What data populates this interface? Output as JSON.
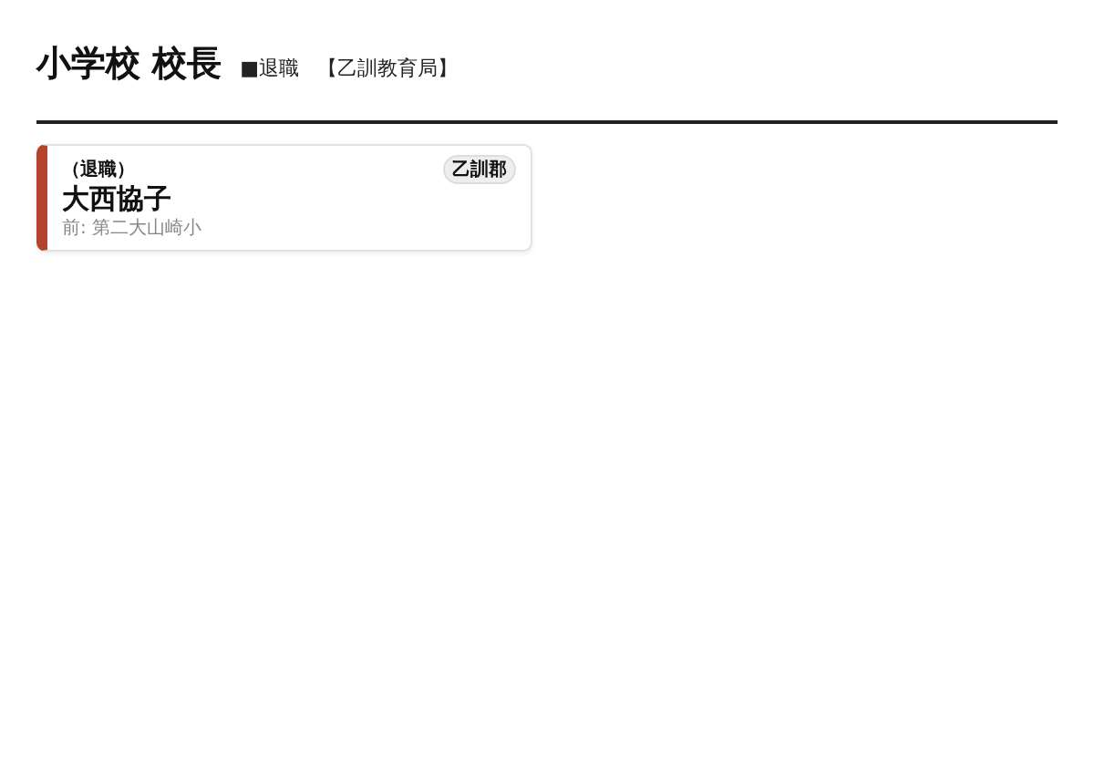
{
  "header": {
    "title": "小学校 校長",
    "status": "■退職",
    "office": "【乙訓教育局】"
  },
  "cards": [
    {
      "note": "（退職）",
      "name": "大西協子",
      "previous": "前: 第二大山崎小",
      "tag": "乙訓郡",
      "color": "#b5432f"
    }
  ]
}
